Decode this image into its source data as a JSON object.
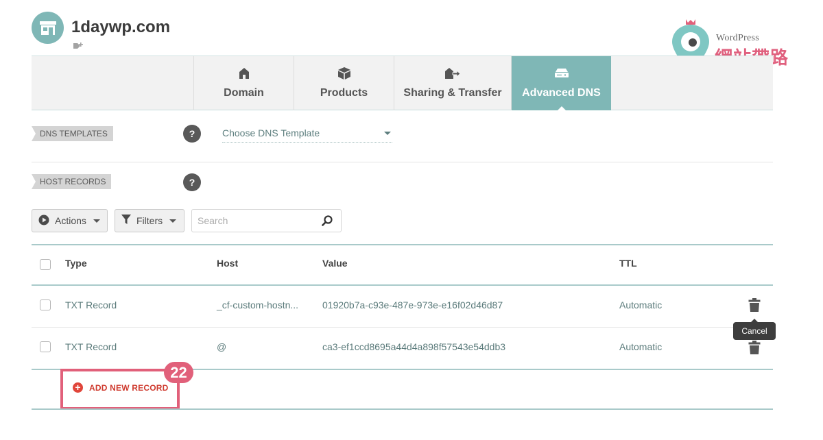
{
  "site": {
    "title": "1daywp.com"
  },
  "brand": {
    "line1": "WordPress",
    "line2": "網站帶路姬"
  },
  "tabs": [
    {
      "label": "Domain",
      "icon": "house-icon"
    },
    {
      "label": "Products",
      "icon": "cube-icon"
    },
    {
      "label": "Sharing & Transfer",
      "icon": "transfer-icon"
    },
    {
      "label": "Advanced DNS",
      "icon": "server-icon",
      "active": true
    }
  ],
  "dns_templates": {
    "label": "DNS TEMPLATES",
    "help": "?",
    "select_value": "Choose DNS Template"
  },
  "host_records": {
    "label": "HOST RECORDS",
    "help": "?"
  },
  "toolbar": {
    "actions_label": "Actions",
    "filters_label": "Filters",
    "search_placeholder": "Search"
  },
  "table": {
    "headers": {
      "type": "Type",
      "host": "Host",
      "value": "Value",
      "ttl": "TTL"
    },
    "rows": [
      {
        "type": "TXT Record",
        "host": "_cf-custom-hostn...",
        "value": "01920b7a-c93e-487e-973e-e16f02d46d87",
        "ttl": "Automatic"
      },
      {
        "type": "TXT Record",
        "host": "@",
        "value": "ca3-ef1ccd8695a44d4a898f57543e54ddb3",
        "ttl": "Automatic"
      }
    ]
  },
  "tooltip": {
    "text": "Cancel"
  },
  "add_record": {
    "label": "ADD NEW RECORD"
  },
  "step_badge": "22",
  "colors": {
    "accent": "#7fb7b6",
    "highlight": "#e1607a",
    "add_red": "#cf3b2f"
  }
}
